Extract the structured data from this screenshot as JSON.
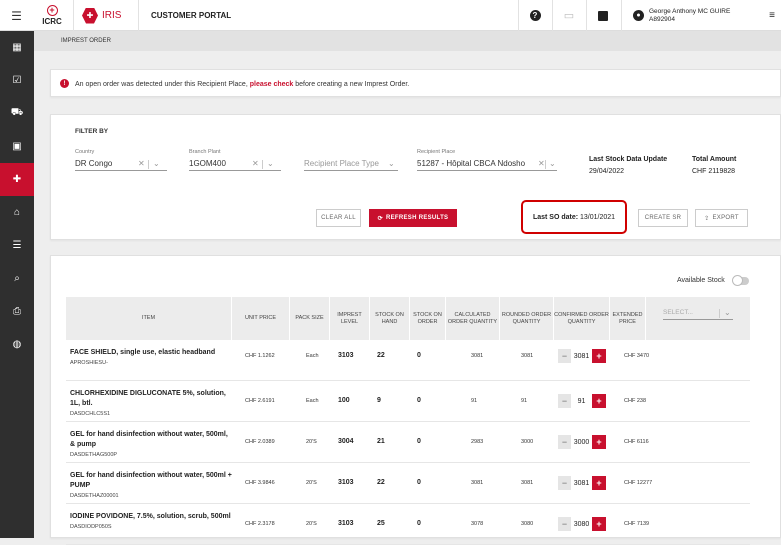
{
  "header": {
    "logo_text": "ICRC",
    "app_name": "IRIS",
    "portal_title": "CUSTOMER PORTAL",
    "user_name": "George Anthony MC GUIRE",
    "user_id": "A892904"
  },
  "breadcrumb": "IMPREST ORDER",
  "alert": {
    "before": "An open order was detected under this Recipient Place, ",
    "link": "please check",
    "after": " before creating a new Imprest Order."
  },
  "filter": {
    "title": "FILTER BY",
    "country_label": "Country",
    "country_value": "DR Congo",
    "branch_label": "Branch Plant",
    "branch_value": "1GOM400",
    "recipient_type_placeholder": "Recipient Place Type",
    "recipient_place_label": "Recipient Place",
    "recipient_place_value": "51287 - Hôpital CBCA Ndosho",
    "stock_update_label": "Last Stock Data Update",
    "stock_update_value": "29/04/2022",
    "total_label": "Total Amount",
    "total_value": "CHF 2119828",
    "clear_label": "CLEAR ALL",
    "refresh_label": "REFRESH RESULTS",
    "last_so_label": "Last SO date:",
    "last_so_value": "13/01/2021",
    "create_sr_label": "CREATE SR",
    "export_label": "EXPORT"
  },
  "table": {
    "available_stock_label": "Available Stock",
    "select_placeholder": "SELECT...",
    "headers": [
      "ITEM",
      "UNIT PRICE",
      "PACK SIZE",
      "IMPREST LEVEL",
      "STOCK ON HAND",
      "STOCK ON ORDER",
      "CALCULATED ORDER QUANTITY",
      "ROUNDED ORDER QUANTITY",
      "CONFIRMED ORDER QUANTITY",
      "EXTENDED PRICE"
    ],
    "rows": [
      {
        "name": "FACE SHIELD, single use, elastic headband",
        "code": "APROSHIESU-",
        "price": "CHF 1.1262",
        "pack": "Each",
        "imprest": "3103",
        "onhand": "22",
        "onorder": "0",
        "calc": "3081",
        "rounded": "3081",
        "confirmed": "3081",
        "extended": "CHF 3470"
      },
      {
        "name": "CHLORHEXIDINE DIGLUCONATE 5%, solution, 1L, btl.",
        "code": "DASDCHLC5S1",
        "price": "CHF 2.6191",
        "pack": "Each",
        "imprest": "100",
        "onhand": "9",
        "onorder": "0",
        "calc": "91",
        "rounded": "91",
        "confirmed": "91",
        "extended": "CHF 238"
      },
      {
        "name": "GEL for hand disinfection without water, 500ml, & pump",
        "code": "DASDETHAG500P",
        "price": "CHF 2.0389",
        "pack": "20'S",
        "imprest": "3004",
        "onhand": "21",
        "onorder": "0",
        "calc": "2983",
        "rounded": "3000",
        "confirmed": "3000",
        "extended": "CHF 6116"
      },
      {
        "name": "GEL for hand disinfection without water, 500ml + PUMP",
        "code": "DASDETHAZ00001",
        "price": "CHF 3.9846",
        "pack": "20'S",
        "imprest": "3103",
        "onhand": "22",
        "onorder": "0",
        "calc": "3081",
        "rounded": "3081",
        "confirmed": "3081",
        "extended": "CHF 12277"
      },
      {
        "name": "IODINE POVIDONE, 7.5%, solution, scrub, 500ml",
        "code": "DASDIODP050S",
        "price": "CHF 2.3178",
        "pack": "20'S",
        "imprest": "3103",
        "onhand": "25",
        "onorder": "0",
        "calc": "3078",
        "rounded": "3080",
        "confirmed": "3080",
        "extended": "CHF 7139"
      }
    ]
  },
  "colors": {
    "brand": "#c8102e",
    "sidebar": "#2f2f2f"
  }
}
